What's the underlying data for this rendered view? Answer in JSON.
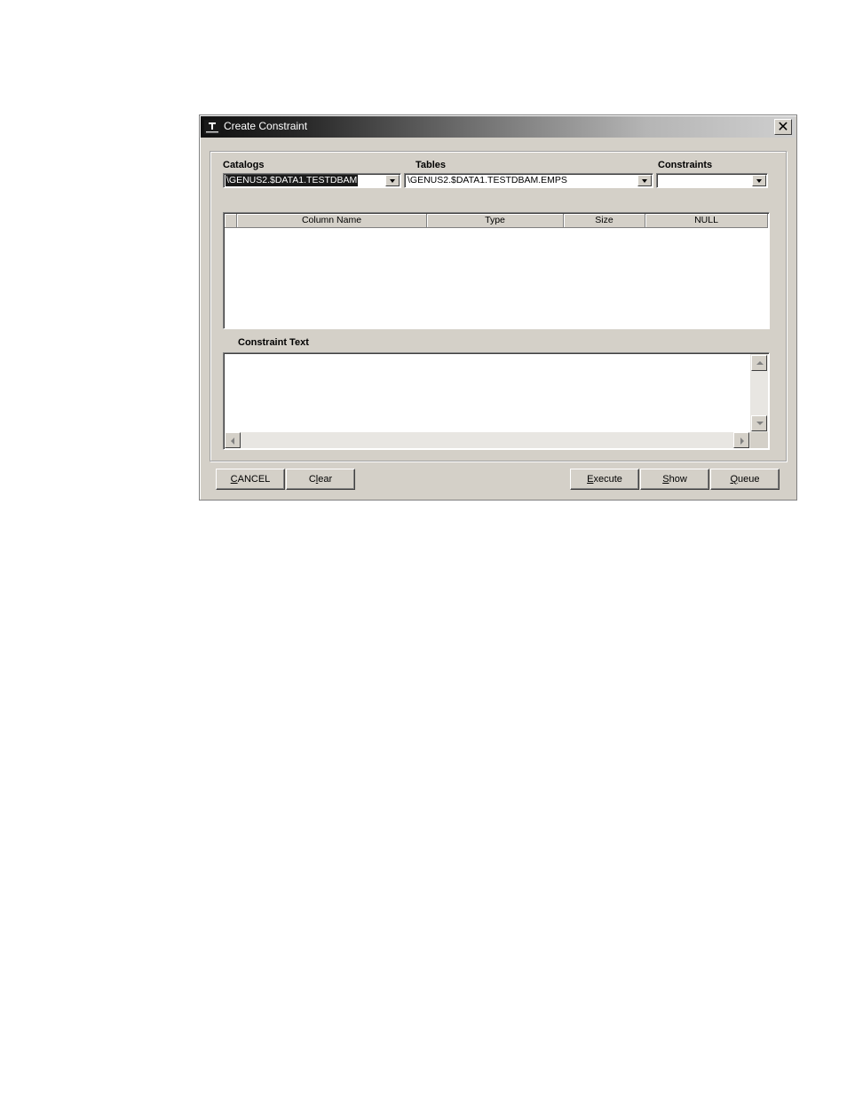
{
  "window": {
    "title": "Create Constraint",
    "close_glyph": "✕",
    "icon": "app-logo-icon"
  },
  "selectors": {
    "catalogs": {
      "label": "Catalogs",
      "value": "\\GENUS2.$DATA1.TESTDBAM"
    },
    "tables": {
      "label": "Tables",
      "value": "\\GENUS2.$DATA1.TESTDBAM.EMPS"
    },
    "constraints": {
      "label": "Constraints",
      "value": ""
    }
  },
  "grid": {
    "columns": [
      "Column Name",
      "Type",
      "Size",
      "NULL"
    ],
    "rows": []
  },
  "constraint_text": {
    "label": "Constraint Text",
    "value": ""
  },
  "buttons": {
    "cancel": {
      "mnemonic": "C",
      "rest": "ANCEL"
    },
    "clear": {
      "pre": "C",
      "mnemonic": "l",
      "rest": "ear"
    },
    "execute": {
      "mnemonic": "E",
      "rest": "xecute"
    },
    "show": {
      "mnemonic": "S",
      "rest": "how"
    },
    "queue": {
      "mnemonic": "Q",
      "rest": "ueue"
    }
  }
}
